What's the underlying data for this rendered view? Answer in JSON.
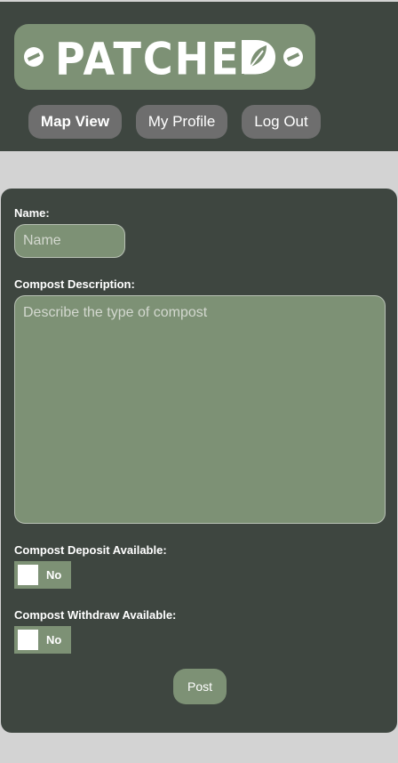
{
  "logo": {
    "text": "PATCHED"
  },
  "nav": {
    "map_view": "Map View",
    "my_profile": "My Profile",
    "log_out": "Log Out"
  },
  "form": {
    "name_label": "Name:",
    "name_placeholder": "Name",
    "description_label": "Compost Description:",
    "description_placeholder": "Describe the type of compost",
    "deposit_label": "Compost Deposit Available:",
    "deposit_value": "No",
    "withdraw_label": "Compost Withdraw Available:",
    "withdraw_value": "No",
    "post_label": "Post"
  },
  "colors": {
    "header_bg": "#3e4640",
    "accent_green": "#7d9175",
    "nav_button": "#6e6e6e",
    "page_bg": "#d3d3d3"
  },
  "icons": [
    "screw-icon",
    "leaf-icon"
  ]
}
